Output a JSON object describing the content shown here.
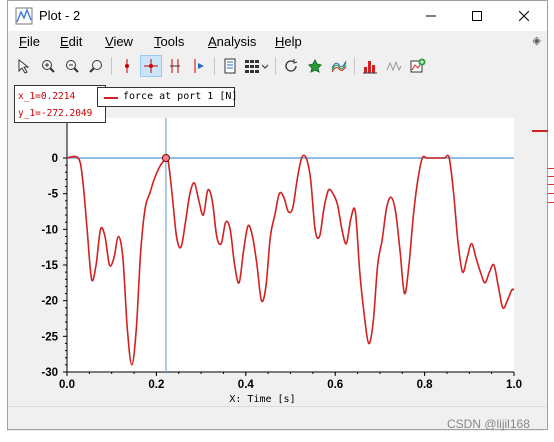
{
  "window": {
    "title": "Plot - 2",
    "controls": {
      "minimize": "—",
      "maximize": "☐",
      "close": "✕"
    }
  },
  "menu": [
    {
      "key": "F",
      "rest": "ile"
    },
    {
      "key": "E",
      "rest": "dit"
    },
    {
      "key": "V",
      "rest": "iew"
    },
    {
      "key": "T",
      "rest": "ools"
    },
    {
      "key": "A",
      "rest": "nalysis"
    },
    {
      "key": "H",
      "rest": "elp"
    }
  ],
  "toolbar": {
    "icons": [
      "select-icon",
      "zoom-in-icon",
      "zoom-out-icon",
      "zoom-reset-icon",
      "vertical-cursor-icon",
      "crosshair-cursor-icon",
      "double-cursor-icon",
      "delta-cursor-icon",
      "data-table-icon",
      "grid-layout-icon",
      "refresh-icon",
      "pin-icon",
      "spectrum-icon",
      "histogram-icon",
      "waveform-icon",
      "add-plot-icon"
    ]
  },
  "readout": {
    "x": "x_1=0.2214",
    "y": "y_1=-272.2049"
  },
  "legend": {
    "label": "force at port 1 [N]",
    "color": "#d32020"
  },
  "watermark": "CSDN @lijil168",
  "chart_data": {
    "type": "line",
    "xlabel": "X: Time [s]",
    "ylabel": "",
    "xlim": [
      0.0,
      1.0
    ],
    "ylim": [
      -30,
      2.5
    ],
    "x_ticks": [
      "0.0",
      "0.2",
      "0.4",
      "0.6",
      "0.8",
      "1.0"
    ],
    "y_ticks": [
      "0",
      "-5",
      "-10",
      "-15",
      "-20",
      "-25",
      "-30"
    ],
    "grid": false,
    "cursor_x": 0.2214,
    "reference_y": 0,
    "series": [
      {
        "name": "force at port 1 [N]",
        "color": "#d32020",
        "x": [
          0.0,
          0.025,
          0.035,
          0.045,
          0.055,
          0.065,
          0.075,
          0.085,
          0.095,
          0.105,
          0.115,
          0.125,
          0.135,
          0.145,
          0.155,
          0.165,
          0.175,
          0.185,
          0.195,
          0.205,
          0.215,
          0.225,
          0.235,
          0.245,
          0.255,
          0.265,
          0.275,
          0.285,
          0.295,
          0.305,
          0.315,
          0.325,
          0.335,
          0.345,
          0.355,
          0.365,
          0.375,
          0.385,
          0.395,
          0.405,
          0.415,
          0.425,
          0.435,
          0.445,
          0.455,
          0.465,
          0.475,
          0.485,
          0.495,
          0.505,
          0.515,
          0.525,
          0.535,
          0.545,
          0.555,
          0.565,
          0.575,
          0.585,
          0.595,
          0.605,
          0.615,
          0.625,
          0.635,
          0.645,
          0.655,
          0.665,
          0.675,
          0.685,
          0.695,
          0.705,
          0.715,
          0.725,
          0.735,
          0.745,
          0.755,
          0.765,
          0.775,
          0.785,
          0.795,
          0.805,
          0.815,
          0.825,
          0.835,
          0.845,
          0.855,
          0.865,
          0.875,
          0.885,
          0.895,
          0.905,
          0.915,
          0.925,
          0.935,
          0.945,
          0.955,
          0.965,
          0.975,
          0.985,
          0.995,
          1.0
        ],
        "y": [
          0,
          0,
          -3,
          -10,
          -17,
          -15,
          -10,
          -11,
          -15,
          -14,
          -11,
          -14,
          -24,
          -29,
          -24,
          -13,
          -7,
          -5,
          -3,
          -1.5,
          -0.5,
          0,
          -5,
          -11,
          -12.5,
          -9,
          -5,
          -3.5,
          -6,
          -8,
          -4.5,
          -6,
          -11,
          -12,
          -9,
          -10,
          -15,
          -17.5,
          -13,
          -9.5,
          -11,
          -15,
          -20,
          -18,
          -11,
          -8,
          -5,
          -5.5,
          -7.5,
          -7,
          -3,
          0,
          0,
          -3,
          -10,
          -11,
          -7,
          -4.5,
          -5,
          -6.5,
          -10,
          -12,
          -8.5,
          -7.5,
          -16,
          -22,
          -26,
          -23,
          -15,
          -11.5,
          -7,
          -5.5,
          -7.5,
          -13,
          -19,
          -15,
          -8,
          -3,
          0,
          0,
          0,
          0,
          0,
          0,
          0,
          -5,
          -12,
          -16,
          -14,
          -12,
          -14,
          -16,
          -17.5,
          -16,
          -15,
          -18,
          -21,
          -20,
          -18.5,
          -18.5
        ]
      }
    ]
  }
}
